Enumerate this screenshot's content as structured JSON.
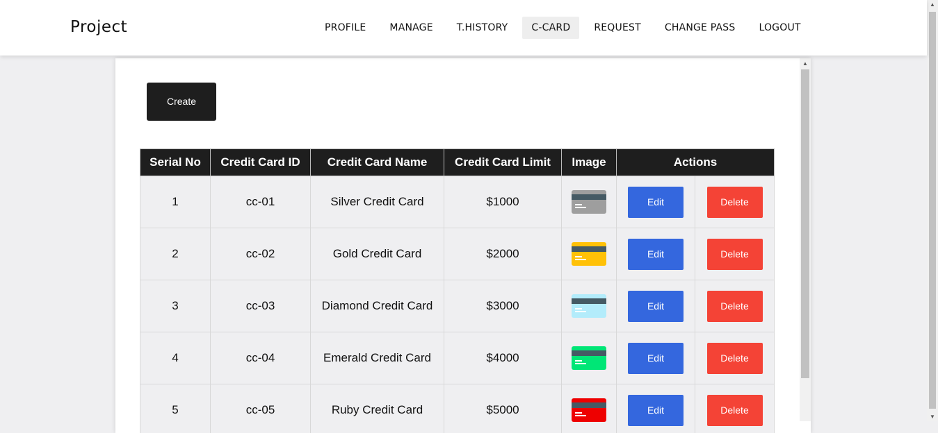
{
  "brand": "Project",
  "nav": [
    {
      "label": "PROFILE",
      "active": false
    },
    {
      "label": "MANAGE",
      "active": false
    },
    {
      "label": "T.HISTORY",
      "active": false
    },
    {
      "label": "C-CARD",
      "active": true
    },
    {
      "label": "REQUEST",
      "active": false
    },
    {
      "label": "CHANGE PASS",
      "active": false
    },
    {
      "label": "LOGOUT",
      "active": false
    }
  ],
  "create_label": "Create",
  "table": {
    "headers": [
      "Serial No",
      "Credit Card ID",
      "Credit Card Name",
      "Credit Card Limit",
      "Image",
      "Actions"
    ],
    "rows": [
      {
        "serial": "1",
        "id": "cc-01",
        "name": "Silver Credit Card",
        "limit": "$1000",
        "card_color": "#9e9e9e",
        "card_icon": "credit-card-icon"
      },
      {
        "serial": "2",
        "id": "cc-02",
        "name": "Gold Credit Card",
        "limit": "$2000",
        "card_color": "#ffc107",
        "card_icon": "credit-card-icon"
      },
      {
        "serial": "3",
        "id": "cc-03",
        "name": "Diamond Credit Card",
        "limit": "$3000",
        "card_color": "#b3ecfb",
        "card_icon": "credit-card-icon"
      },
      {
        "serial": "4",
        "id": "cc-04",
        "name": "Emerald Credit Card",
        "limit": "$4000",
        "card_color": "#00e676",
        "card_icon": "credit-card-icon"
      },
      {
        "serial": "5",
        "id": "cc-05",
        "name": "Ruby Credit Card",
        "limit": "$5000",
        "card_color": "#ee0000",
        "card_icon": "credit-card-icon"
      }
    ],
    "edit_label": "Edit",
    "delete_label": "Delete"
  },
  "colors": {
    "edit": "#3467de",
    "delete": "#f44336",
    "header_bg": "#1e1e1e"
  }
}
